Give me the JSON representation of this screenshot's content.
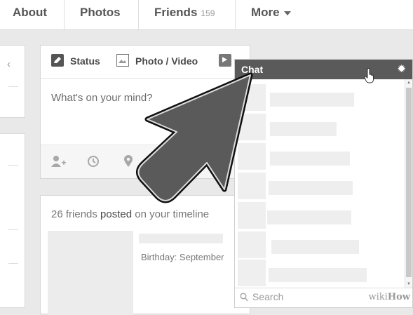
{
  "nav": {
    "about": "About",
    "photos": "Photos",
    "friends": "Friends",
    "friends_count": "159",
    "more": "More"
  },
  "composer": {
    "tab_status": "Status",
    "tab_photo_video": "Photo / Video",
    "placeholder": "What's on your mind?",
    "action_icons": [
      "tag-friends-icon",
      "clock-icon",
      "location-pin-icon",
      "camera-icon"
    ]
  },
  "timeline_post": {
    "count_text": "26 friends",
    "verb": "posted",
    "rest": "on your timeline",
    "birthday": "Birthday: September"
  },
  "chat": {
    "title": "Chat",
    "search_placeholder": "Search",
    "watermark_wiki": "wiki",
    "watermark_how": "How"
  },
  "colors": {
    "chat_header": "#5a5a5a",
    "page_bg": "#e9e9e9"
  }
}
